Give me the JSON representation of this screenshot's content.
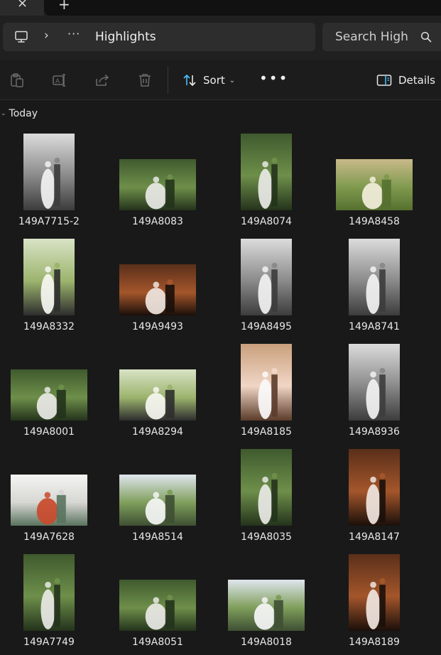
{
  "tabs": {
    "close_glyph": "×",
    "add_glyph": "+"
  },
  "address": {
    "chevron": "›",
    "overflow": "···",
    "current": "Highlights"
  },
  "search": {
    "placeholder": "Search High"
  },
  "toolbar": {
    "sort_label": "Sort",
    "sort_caret": "⌄",
    "more_label": "•••",
    "details_label": "Details"
  },
  "group": {
    "caret": "⌄",
    "label": "Today"
  },
  "colors": {
    "background": "#191919",
    "chrome": "#202020",
    "field": "#2d2d2d",
    "accent": "#4cc2ff"
  },
  "files": [
    {
      "name": "149A7715-2",
      "orientation": "portrait",
      "tone": "bw"
    },
    {
      "name": "149A8083",
      "orientation": "landscape",
      "tone": "outdoor"
    },
    {
      "name": "149A8074",
      "orientation": "portrait",
      "tone": "outdoor"
    },
    {
      "name": "149A8458",
      "orientation": "landscape",
      "tone": "sunset"
    },
    {
      "name": "149A8332",
      "orientation": "portrait",
      "tone": "bright"
    },
    {
      "name": "149A9493",
      "orientation": "landscape",
      "tone": "indoor"
    },
    {
      "name": "149A8495",
      "orientation": "portrait",
      "tone": "bw"
    },
    {
      "name": "149A8741",
      "orientation": "portrait",
      "tone": "bw"
    },
    {
      "name": "149A8001",
      "orientation": "landscape",
      "tone": "outdoor"
    },
    {
      "name": "149A8294",
      "orientation": "landscape",
      "tone": "bright"
    },
    {
      "name": "149A8185",
      "orientation": "portrait",
      "tone": "indoor-light"
    },
    {
      "name": "149A8936",
      "orientation": "portrait",
      "tone": "bw"
    },
    {
      "name": "149A7628",
      "orientation": "landscape",
      "tone": "white"
    },
    {
      "name": "149A8514",
      "orientation": "landscape",
      "tone": "sky"
    },
    {
      "name": "149A8035",
      "orientation": "portrait",
      "tone": "outdoor"
    },
    {
      "name": "149A8147",
      "orientation": "portrait",
      "tone": "indoor"
    },
    {
      "name": "149A7749",
      "orientation": "portrait",
      "tone": "outdoor"
    },
    {
      "name": "149A8051",
      "orientation": "landscape",
      "tone": "outdoor"
    },
    {
      "name": "149A8018",
      "orientation": "landscape",
      "tone": "sky"
    },
    {
      "name": "149A8189",
      "orientation": "portrait",
      "tone": "indoor"
    }
  ]
}
